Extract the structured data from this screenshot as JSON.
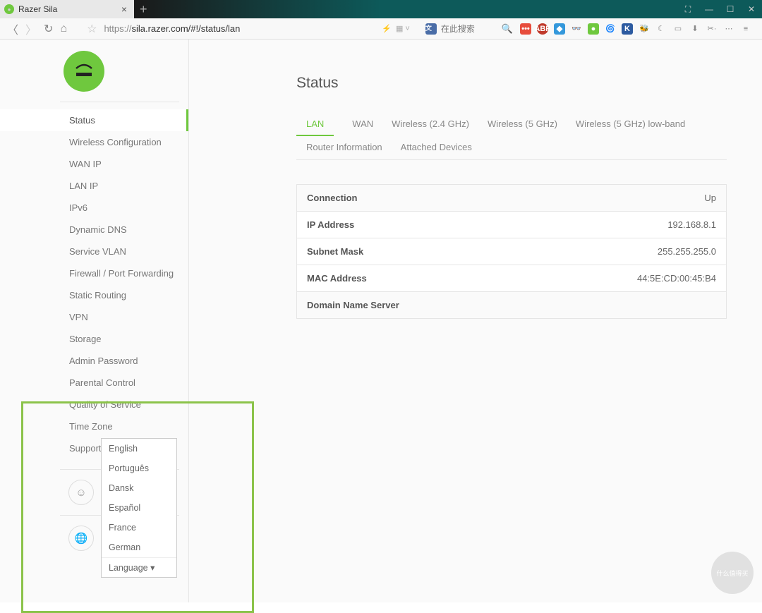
{
  "browser": {
    "tab_title": "Razer Sila",
    "url_proto": "https://",
    "url_path": "sila.razer.com/#!/status/lan",
    "search_placeholder": "在此搜索"
  },
  "sidebar": {
    "items": [
      "Status",
      "Wireless Configuration",
      "WAN IP",
      "LAN IP",
      "IPv6",
      "Dynamic DNS",
      "Service VLAN",
      "Firewall / Port Forwarding",
      "Static Routing",
      "VPN",
      "Storage",
      "Admin Password",
      "Parental Control",
      "Quality of Service",
      "Time Zone",
      "Support"
    ]
  },
  "language": {
    "label": "Language ▾",
    "options": [
      "English",
      "Português",
      "Dansk",
      "Español",
      "France",
      "German"
    ]
  },
  "page": {
    "title": "Status",
    "tabs": [
      "LAN",
      "WAN",
      "Wireless (2.4 GHz)",
      "Wireless (5 GHz)",
      "Wireless (5 GHz) low-band"
    ],
    "subtabs": [
      "Router Information",
      "Attached Devices"
    ],
    "rows": [
      {
        "label": "Connection",
        "value": "Up"
      },
      {
        "label": "IP Address",
        "value": "192.168.8.1"
      },
      {
        "label": "Subnet Mask",
        "value": "255.255.255.0"
      },
      {
        "label": "MAC Address",
        "value": "44:5E:CD:00:45:B4"
      },
      {
        "label": "Domain Name Server",
        "value": ""
      }
    ]
  },
  "watermark": "什么值得买"
}
